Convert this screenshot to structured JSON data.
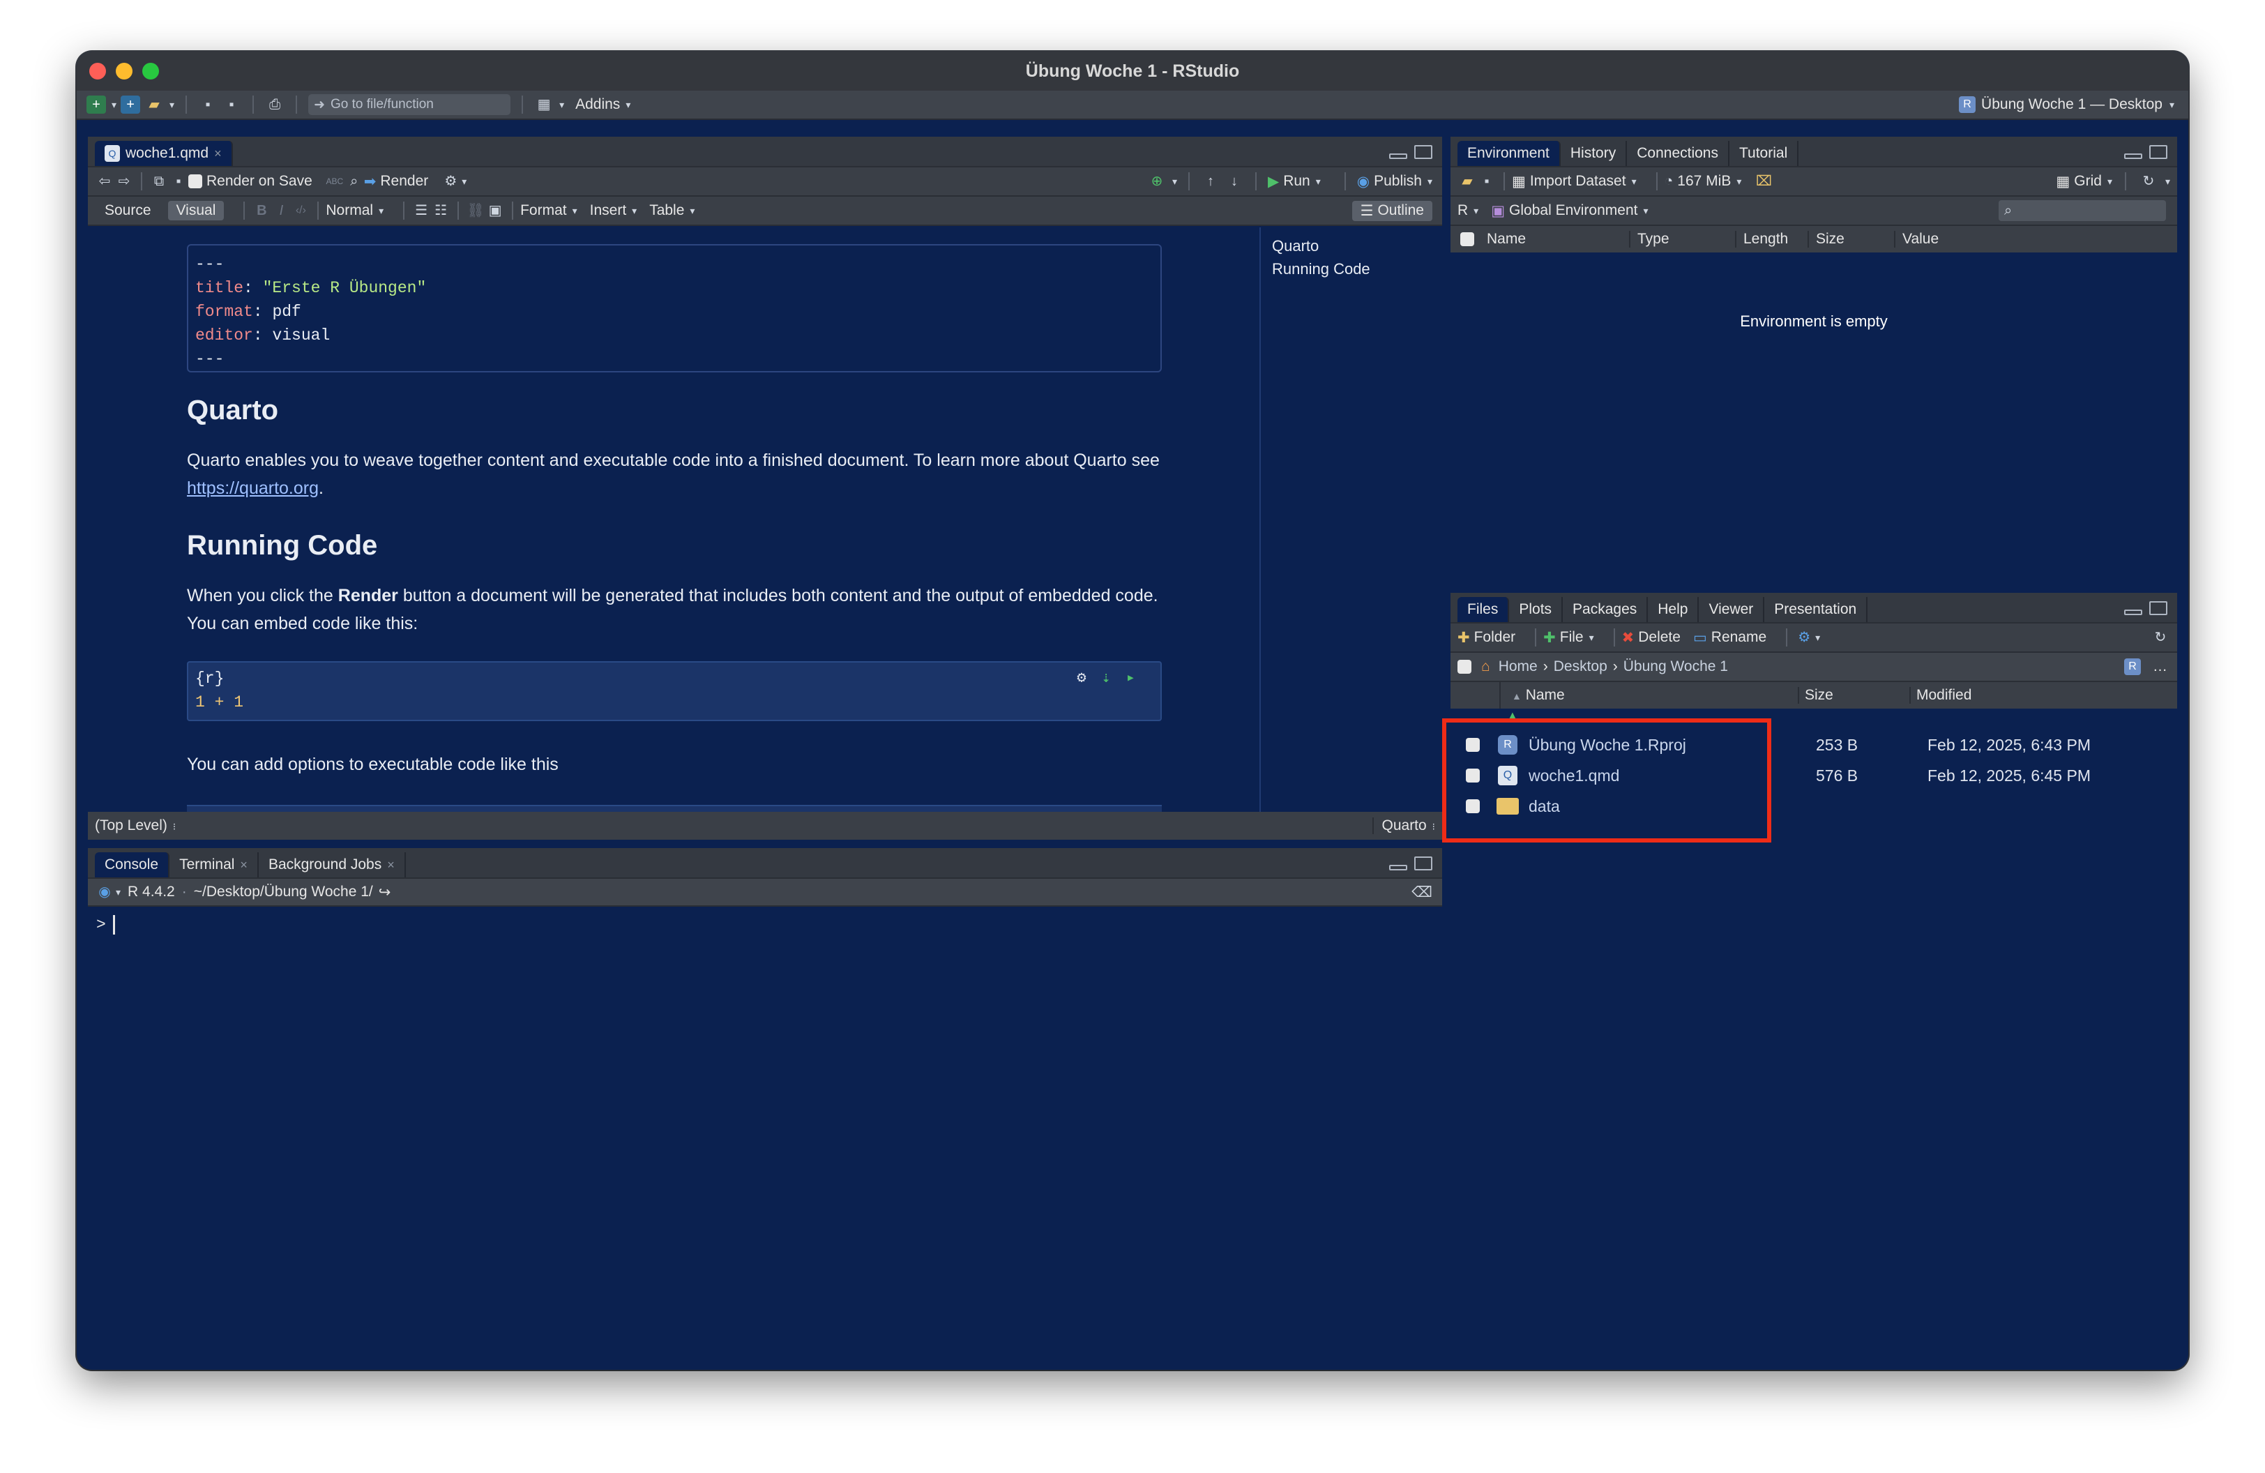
{
  "window": {
    "title": "Übung Woche 1 - RStudio"
  },
  "toolbar": {
    "goto_placeholder": "Go to file/function",
    "addins_label": "Addins",
    "project_label": "Übung Woche 1 — Desktop"
  },
  "editor": {
    "tab_label": "woche1.qmd",
    "render_on_save": "Render on Save",
    "render_label": "Render",
    "run_label": "Run",
    "publish_label": "Publish",
    "mode_source": "Source",
    "mode_visual": "Visual",
    "normal_label": "Normal",
    "format_label": "Format",
    "insert_label": "Insert",
    "table_label": "Table",
    "outline_label": "Outline",
    "yaml_lines": [
      {
        "text": "---"
      },
      {
        "key": "title",
        "value": "\"Erste R Übungen\""
      },
      {
        "key": "format",
        "value": "pdf"
      },
      {
        "key": "editor",
        "value": "visual"
      },
      {
        "text": "---"
      }
    ],
    "h1": "Quarto",
    "p1_a": "Quarto enables you to weave together content and executable code into a finished document. To learn more about Quarto see ",
    "p1_link": "https://quarto.org",
    "p1_b": ".",
    "h2": "Running Code",
    "p2_a": "When you click the ",
    "p2_bold": "Render",
    "p2_b": " button a document will be generated that includes both content and the output of embedded code. You can embed code like this:",
    "code_lang": "{r}",
    "code_line": "1 + 1",
    "p3": "You can add options to executable code like this",
    "outline_items": [
      "Quarto",
      "Running Code"
    ],
    "status_left": "(Top Level)",
    "status_right": "Quarto"
  },
  "console": {
    "tabs": [
      "Console",
      "Terminal",
      "Background Jobs"
    ],
    "version": "R 4.4.2",
    "path": "~/Desktop/Übung Woche 1/",
    "prompt": ">"
  },
  "env": {
    "tabs": [
      "Environment",
      "History",
      "Connections",
      "Tutorial"
    ],
    "import_label": "Import Dataset",
    "memory_label": "167 MiB",
    "grid_label": "Grid",
    "lang_label": "R",
    "scope_label": "Global Environment",
    "columns": [
      "Name",
      "Type",
      "Length",
      "Size",
      "Value"
    ],
    "empty_msg": "Environment is empty"
  },
  "files": {
    "tabs": [
      "Files",
      "Plots",
      "Packages",
      "Help",
      "Viewer",
      "Presentation"
    ],
    "folder_label": "Folder",
    "file_label": "File",
    "delete_label": "Delete",
    "rename_label": "Rename",
    "breadcrumb": [
      "Home",
      "Desktop",
      "Übung Woche 1"
    ],
    "columns": [
      "Name",
      "Size",
      "Modified"
    ],
    "rows": [
      {
        "name": "Übung Woche 1.Rproj",
        "size": "253 B",
        "modified": "Feb 12, 2025, 6:43 PM",
        "icon": "rproj-icon"
      },
      {
        "name": "woche1.qmd",
        "size": "576 B",
        "modified": "Feb 12, 2025, 6:45 PM",
        "icon": "qmd-file-icon"
      },
      {
        "name": "data",
        "size": "",
        "modified": "",
        "icon": "folder-icon"
      }
    ]
  },
  "colors": {
    "highlight": "#ef2c17",
    "background": "#0b2150"
  }
}
